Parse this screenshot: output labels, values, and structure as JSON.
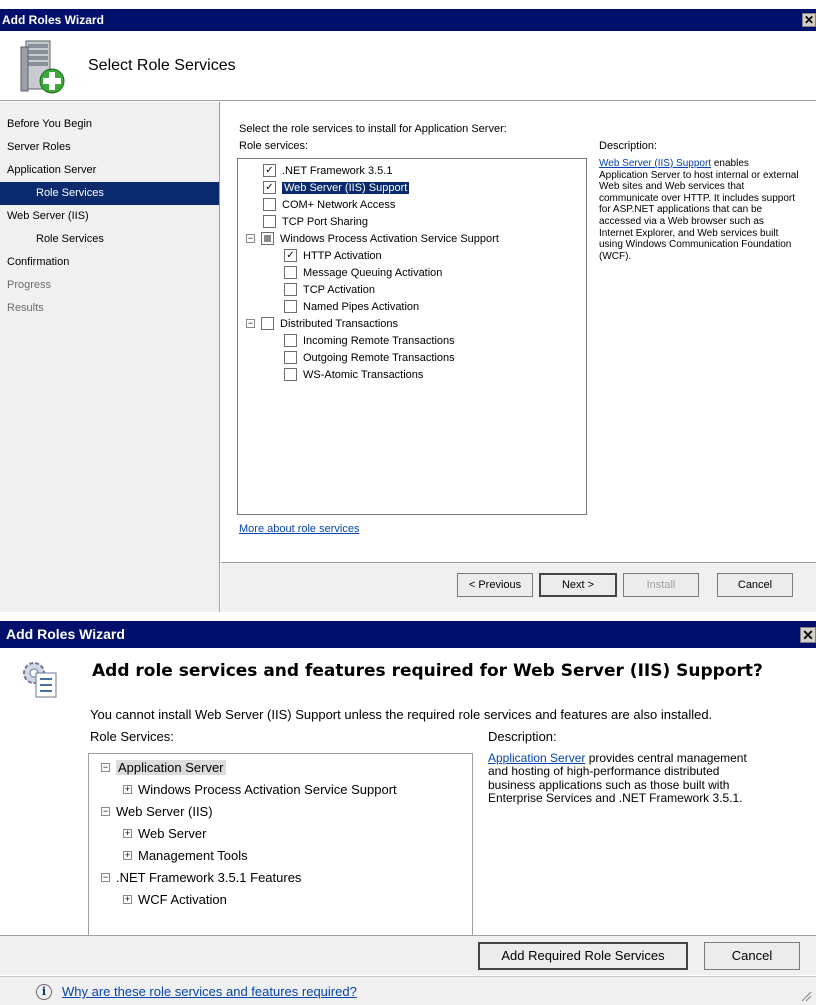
{
  "wizard1": {
    "title": "Add Roles Wizard",
    "close_glyph": "✕",
    "header_title": "Select Role Services",
    "nav": [
      {
        "label": "Before You Begin",
        "state": "normal",
        "level": 0
      },
      {
        "label": "Server Roles",
        "state": "normal",
        "level": 0
      },
      {
        "label": "Application Server",
        "state": "normal",
        "level": 0
      },
      {
        "label": "Role Services",
        "state": "selected",
        "level": 1
      },
      {
        "label": "Web Server (IIS)",
        "state": "normal",
        "level": 0
      },
      {
        "label": "Role Services",
        "state": "normal",
        "level": 1
      },
      {
        "label": "Confirmation",
        "state": "normal",
        "level": 0
      },
      {
        "label": "Progress",
        "state": "disabled",
        "level": 0
      },
      {
        "label": "Results",
        "state": "disabled",
        "level": 0
      }
    ],
    "instruction": "Select the role services to install for Application Server:",
    "role_services_label": "Role services:",
    "description_label": "Description:",
    "description_link": "Web Server (IIS) Support",
    "description_text": " enables Application Server to host internal or external Web sites and Web services that communicate over HTTP. It includes support for ASP.NET applications that can be accessed via a Web browser such as Internet Explorer, and Web services built using Windows Communication Foundation (WCF).",
    "tree": [
      {
        "label": ".NET Framework 3.5.1",
        "checked": "checked",
        "level": 0,
        "expander": ""
      },
      {
        "label": "Web Server (IIS) Support",
        "checked": "checked",
        "level": 0,
        "expander": "",
        "selected": true
      },
      {
        "label": "COM+ Network Access",
        "checked": "unchecked",
        "level": 0,
        "expander": ""
      },
      {
        "label": "TCP Port Sharing",
        "checked": "unchecked",
        "level": 0,
        "expander": ""
      },
      {
        "label": "Windows Process Activation Service Support",
        "checked": "partial",
        "level": 0,
        "expander": "−"
      },
      {
        "label": "HTTP Activation",
        "checked": "checked",
        "level": 1,
        "expander": ""
      },
      {
        "label": "Message Queuing Activation",
        "checked": "unchecked",
        "level": 1,
        "expander": ""
      },
      {
        "label": "TCP Activation",
        "checked": "unchecked",
        "level": 1,
        "expander": ""
      },
      {
        "label": "Named Pipes Activation",
        "checked": "unchecked",
        "level": 1,
        "expander": ""
      },
      {
        "label": "Distributed Transactions",
        "checked": "unchecked",
        "level": 0,
        "expander": "−"
      },
      {
        "label": "Incoming Remote Transactions",
        "checked": "unchecked",
        "level": 1,
        "expander": ""
      },
      {
        "label": "Outgoing Remote Transactions",
        "checked": "unchecked",
        "level": 1,
        "expander": ""
      },
      {
        "label": "WS-Atomic Transactions",
        "checked": "unchecked",
        "level": 1,
        "expander": ""
      }
    ],
    "more_link": "More about role services",
    "buttons": {
      "previous": "< Previous",
      "next": "Next >",
      "install": "Install",
      "cancel": "Cancel"
    }
  },
  "wizard2": {
    "title": "Add Roles Wizard",
    "close_glyph": "✕",
    "heading": "Add role services and features required for Web Server (IIS) Support?",
    "subtext": "You cannot install Web Server (IIS) Support unless the required role services and features are also installed.",
    "role_services_label": "Role Services:",
    "description_label": "Description:",
    "tree": [
      {
        "label": "Application Server",
        "expander": "−",
        "level": 0,
        "highlight": true
      },
      {
        "label": "Windows Process Activation Service Support",
        "expander": "+",
        "level": 1
      },
      {
        "label": "Web Server (IIS)",
        "expander": "−",
        "level": 0
      },
      {
        "label": "Web Server",
        "expander": "+",
        "level": 1
      },
      {
        "label": "Management Tools",
        "expander": "+",
        "level": 1
      },
      {
        "label": ".NET Framework 3.5.1 Features",
        "expander": "−",
        "level": 0
      },
      {
        "label": "WCF Activation",
        "expander": "+",
        "level": 1
      }
    ],
    "description_link": "Application Server",
    "description_text": " provides central management and hosting of high-performance distributed business applications such as those built with Enterprise Services and .NET Framework 3.5.1.",
    "buttons": {
      "add": "Add Required Role Services",
      "cancel": "Cancel"
    },
    "footer_link": "Why are these role services and features required?",
    "info_glyph": "i"
  }
}
